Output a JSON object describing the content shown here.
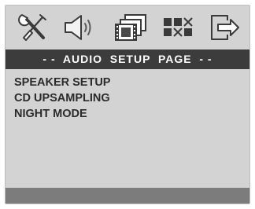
{
  "header": {
    "title": "- -  AUDIO  SETUP  PAGE  - -"
  },
  "toolbar": {
    "icons": [
      {
        "name": "general-setup-icon"
      },
      {
        "name": "audio-setup-icon"
      },
      {
        "name": "video-setup-icon"
      },
      {
        "name": "preference-setup-icon"
      },
      {
        "name": "exit-setup-icon"
      }
    ]
  },
  "menu": {
    "items": [
      {
        "label": "SPEAKER SETUP"
      },
      {
        "label": "CD UPSAMPLING"
      },
      {
        "label": "NIGHT MODE"
      }
    ]
  },
  "colors": {
    "screen_bg": "#d3d3d3",
    "title_bar_bg": "#3c3c3c",
    "title_text": "#ffffff",
    "menu_text": "#2b2b2b",
    "bottom_bar_bg": "#7c7c7c"
  }
}
